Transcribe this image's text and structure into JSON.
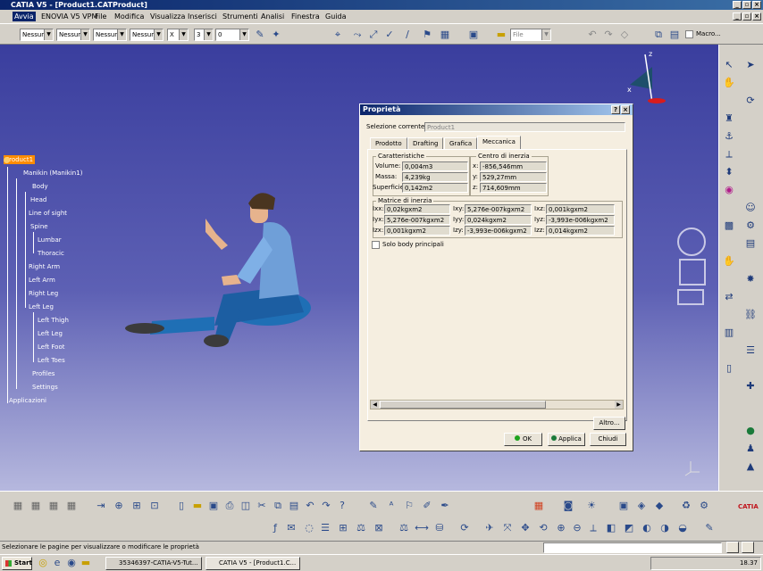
{
  "window": {
    "title": "CATIA V5 - [Product1.CATProduct]"
  },
  "menu": [
    "Avvia",
    "ENOVIA V5 VPM",
    "File",
    "Modifica",
    "Visualizza",
    "Inserisci",
    "Strumenti",
    "Analisi",
    "Finestra",
    "Guida"
  ],
  "toolbar": {
    "combos": [
      "Nessun",
      "Nessun",
      "Nessun",
      "Nessun"
    ],
    "combo_small1": "X",
    "combo_small2": "3",
    "combo_small3": "0",
    "file_combo": "File",
    "macro_label": "Macro..."
  },
  "tree": {
    "root": "Product1",
    "items": [
      "Manikin (Manikin1)",
      "Body",
      "Head",
      "Line of sight",
      "Spine",
      "Lumbar",
      "Thoracic",
      "Right Arm",
      "Left Arm",
      "Right Leg",
      "Left Leg",
      "Left Thigh",
      "Left Leg",
      "Left Foot",
      "Left Toes",
      "Profiles",
      "Settings",
      "Applicazioni"
    ]
  },
  "dialog": {
    "title": "Proprietà",
    "current_selection_label": "Selezione corrente:",
    "current_selection_value": "Product1",
    "tabs": [
      "Prodotto",
      "Drafting",
      "Grafica",
      "Meccanica"
    ],
    "active_tab": "Meccanica",
    "characteristics_label": "Caratteristiche",
    "volume_label": "Volume:",
    "volume_value": "0,004m3",
    "mass_label": "Massa:",
    "mass_value": "4,239kg",
    "surface_label": "Superficie:",
    "surface_value": "0,142m2",
    "cog_label": "Centro di inerzia",
    "cog_x_label": "x:",
    "cog_x": "-856,546mm",
    "cog_y_label": "y:",
    "cog_y": "529,27mm",
    "cog_z_label": "z:",
    "cog_z": "714,609mm",
    "inertia_label": "Matrice di inerzia",
    "matrix": [
      [
        "Ixx:",
        "0,02kgxm2",
        "Ixy:",
        "5,276e-007kgxm2",
        "Ixz:",
        "0,001kgxm2"
      ],
      [
        "Iyx:",
        "5,276e-007kgxm2",
        "Iyy:",
        "0,024kgxm2",
        "Iyz:",
        "-3,993e-006kgxm2"
      ],
      [
        "Izx:",
        "0,001kgxm2",
        "Izy:",
        "-3,993e-006kgxm2",
        "Izz:",
        "0,014kgxm2"
      ]
    ],
    "only_main_body": "Solo body principali",
    "other_button": "Altro...",
    "ok_button": "OK",
    "apply_button": "Applica",
    "close_button": "Chiudi"
  },
  "status": {
    "text": "Selezionare le pagine per visualizzare o modificare le proprietà"
  },
  "taskbar": {
    "start": "Start",
    "tasks": [
      "35346397-CATIA-V5-Tut...",
      "CATIA V5 - [Product1.C..."
    ],
    "clock": "18.37"
  },
  "brand": "CATIA",
  "colors": {
    "title_blue": "#0a246a",
    "viewport_top": "#3a3e9e",
    "tree_root_bg": "#ff8c00"
  }
}
